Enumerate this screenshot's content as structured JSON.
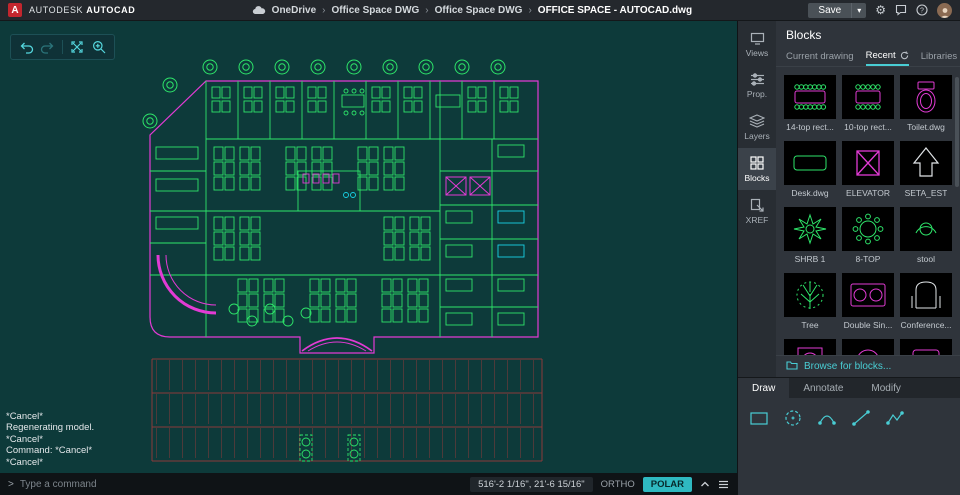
{
  "colors": {
    "accent": "#49cdd4",
    "magenta": "#e23bd4",
    "green": "#2ee56a",
    "canvas_bg": "#0d3a3a",
    "polar_active": "#2fb9c1"
  },
  "icons": {
    "gear": "⚙",
    "save_caret": "▾",
    "breadcrumb_sep": "›",
    "prompt": ">"
  },
  "topbar": {
    "brand_primary": "AUTODESK",
    "brand_secondary": "AUTOCAD",
    "breadcrumb": [
      "OneDrive",
      "Office Space DWG",
      "Office Space DWG",
      "OFFICE SPACE - AUTOCAD.dwg"
    ],
    "save_label": "Save"
  },
  "sidebar": {
    "items": [
      "Views",
      "Prop.",
      "Layers",
      "Blocks",
      "XREF"
    ],
    "active": "Blocks"
  },
  "blocks_panel": {
    "title": "Blocks",
    "tabs": [
      "Current drawing",
      "Recent",
      "Libraries"
    ],
    "active_tab": "Recent",
    "items": [
      "14-top rect...",
      "10-top rect...",
      "Toilet.dwg",
      "Desk.dwg",
      "ELEVATOR",
      "SETA_EST",
      "SHRB 1",
      "8-TOP",
      "stool",
      "Tree",
      "Double Sin...",
      "Conference..."
    ],
    "browse_label": "Browse for blocks..."
  },
  "ribbon": {
    "tabs": [
      "Draw",
      "Annotate",
      "Modify"
    ],
    "active_tab": "Draw"
  },
  "command": {
    "history": [
      "*Cancel*",
      "Regenerating model.",
      "*Cancel*",
      "Command: *Cancel*",
      "*Cancel*"
    ],
    "placeholder": "Type a command"
  },
  "statusbar": {
    "coordinates": "516'-2 1/16\", 21'-6 15/16\"",
    "ortho_label": "ORTHO",
    "polar_label": "POLAR"
  }
}
